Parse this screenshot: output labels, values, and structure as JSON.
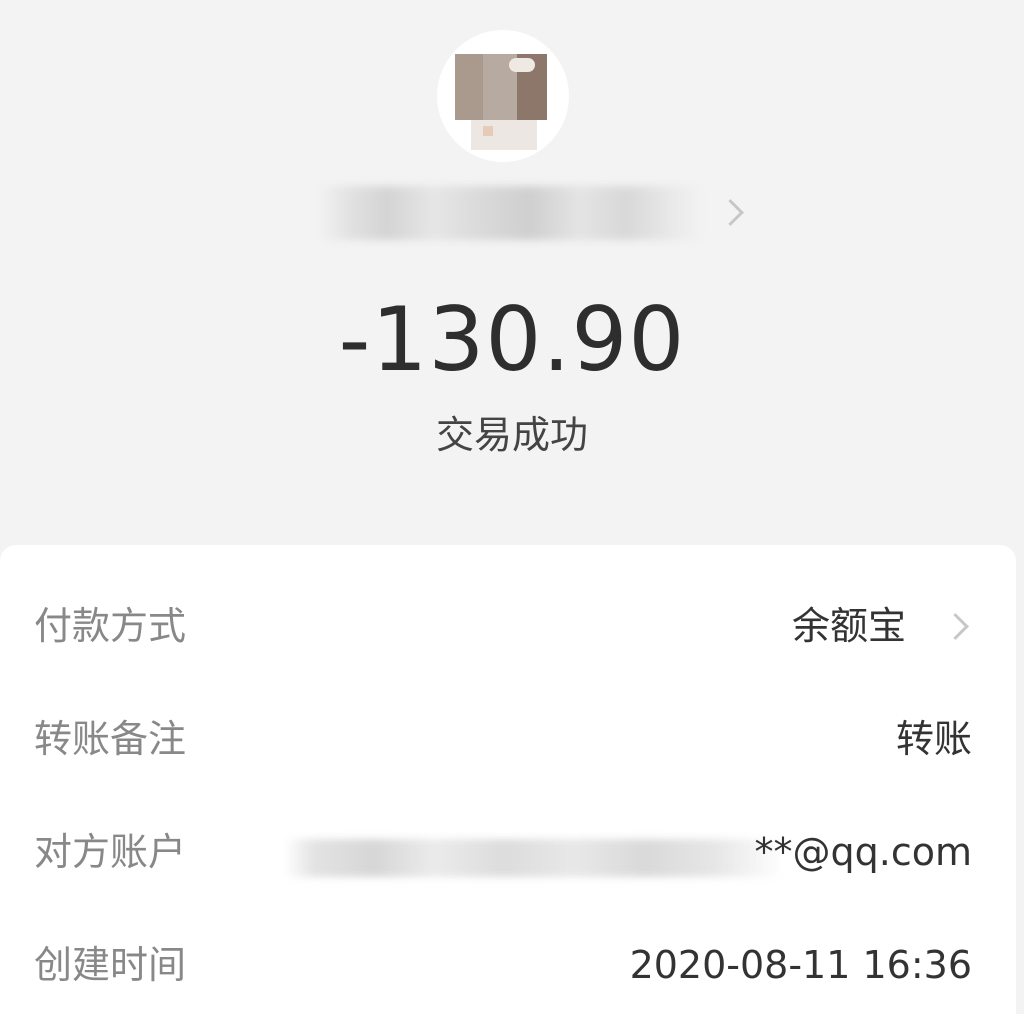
{
  "transaction": {
    "amount": "-130.90",
    "status": "交易成功"
  },
  "details": [
    {
      "label": "付款方式",
      "value": "余额宝"
    },
    {
      "label": "转账备注",
      "value": "转账"
    },
    {
      "label": "对方账户",
      "value": "**@qq.com"
    },
    {
      "label": "创建时间",
      "value": "2020-08-11 16:36"
    }
  ],
  "icons": {
    "name_chevron": "chevron-right-icon",
    "payment_chevron": "chevron-right-icon"
  },
  "colors": {
    "background": "#f3f3f3",
    "card": "#ffffff",
    "label": "#888888",
    "value": "#333333",
    "chevron": "#c7c7c7"
  }
}
